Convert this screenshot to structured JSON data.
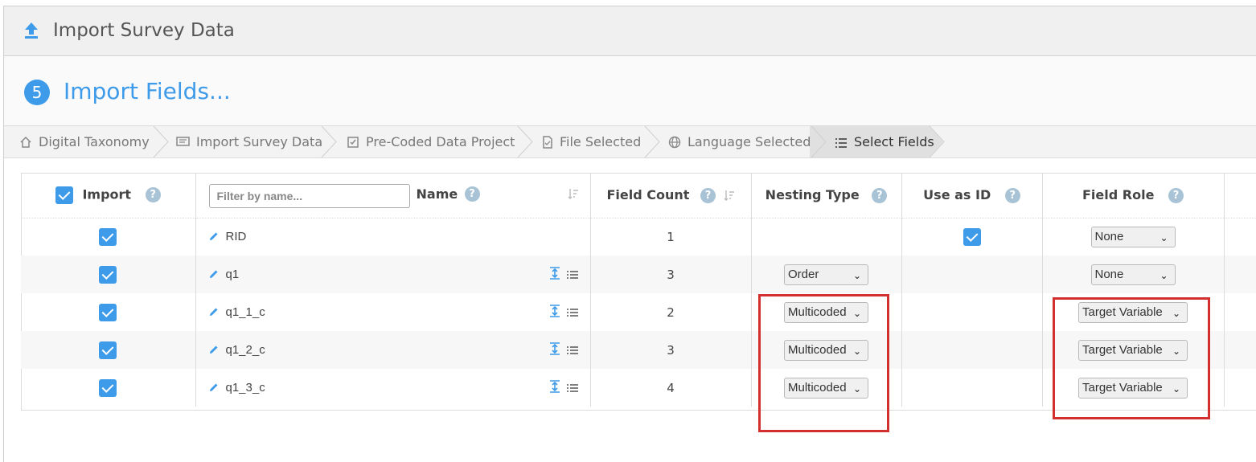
{
  "header": {
    "title": "Import Survey Data",
    "icon": "upload-icon"
  },
  "step": {
    "number": "5",
    "title": "Import Fields..."
  },
  "breadcrumbs": [
    {
      "label": "Digital Taxonomy",
      "icon": "home-icon"
    },
    {
      "label": "Import Survey Data",
      "icon": "message-icon"
    },
    {
      "label": "Pre-Coded Data Project",
      "icon": "checkbox-icon"
    },
    {
      "label": "File Selected",
      "icon": "file-icon"
    },
    {
      "label": "Language Selected",
      "icon": "globe-icon"
    },
    {
      "label": "Select Fields",
      "icon": "list-icon"
    }
  ],
  "table": {
    "headers": {
      "import": "Import",
      "filter_placeholder": "Filter by name...",
      "name": "Name",
      "field_count": "Field Count",
      "nesting_type": "Nesting Type",
      "use_as_id": "Use as ID",
      "field_role": "Field Role"
    },
    "help_glyph": "?",
    "rows": [
      {
        "name": "RID",
        "count": "1",
        "nesting": "",
        "use_as_id": true,
        "role": "None"
      },
      {
        "name": "q1",
        "count": "3",
        "nesting": "Order",
        "use_as_id": false,
        "role": "None"
      },
      {
        "name": "q1_1_c",
        "count": "2",
        "nesting": "Multicoded",
        "use_as_id": false,
        "role": "Target Variable"
      },
      {
        "name": "q1_2_c",
        "count": "3",
        "nesting": "Multicoded",
        "use_as_id": false,
        "role": "Target Variable"
      },
      {
        "name": "q1_3_c",
        "count": "4",
        "nesting": "Multicoded",
        "use_as_id": false,
        "role": "Target Variable"
      }
    ]
  },
  "colors": {
    "accent": "#3d9be9",
    "highlight": "#d32f2f"
  }
}
